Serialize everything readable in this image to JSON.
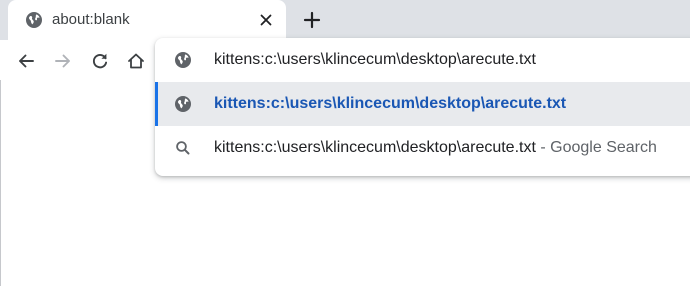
{
  "tab": {
    "title": "about:blank"
  },
  "toolbar": {
    "icons": [
      "back-arrow-icon",
      "forward-arrow-icon",
      "reload-icon",
      "home-icon"
    ]
  },
  "omnibox": {
    "input_value": "kittens:c:\\users\\klincecum\\desktop\\arecute.txt",
    "suggestions": [
      {
        "text": "kittens:c:\\users\\klincecum\\desktop\\arecute.txt",
        "icon": "globe-icon",
        "selected": true
      },
      {
        "text": "kittens:c:\\users\\klincecum\\desktop\\arecute.txt",
        "separator": "-",
        "hint": "Google Search",
        "icon": "search-icon",
        "selected": false
      }
    ]
  },
  "colors": {
    "tabstrip": "#dee1e6",
    "selection_bar": "#1a73e8",
    "selected_text": "#1a57b4",
    "selected_row_bg": "#e8eaed"
  }
}
